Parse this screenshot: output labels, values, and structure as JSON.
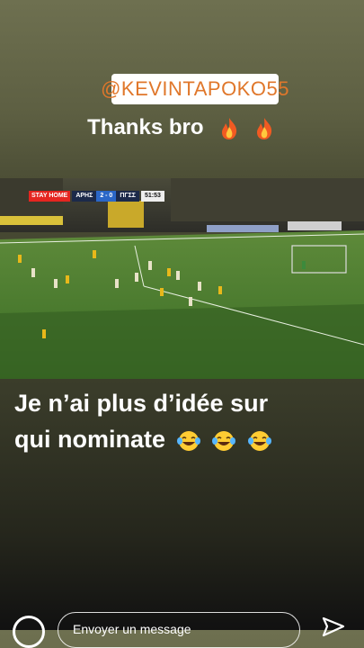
{
  "story": {
    "mention": "@KEVINTAPOKO55",
    "caption1": "Thanks bro",
    "caption2_line1": "Je n’ai plus d’idée sur",
    "caption2_line2": "qui nominate"
  },
  "video": {
    "scorebug": {
      "logo": "STAY HOME",
      "home": "ΑΡΗΣ",
      "score": "2 - 0",
      "away": "ΠΓΣΣ",
      "time": "51:53"
    }
  },
  "reply": {
    "placeholder": "Envoyer un message"
  },
  "icons": [
    "fire-icon",
    "laughing-tears-icon",
    "camera-icon",
    "send-icon"
  ]
}
